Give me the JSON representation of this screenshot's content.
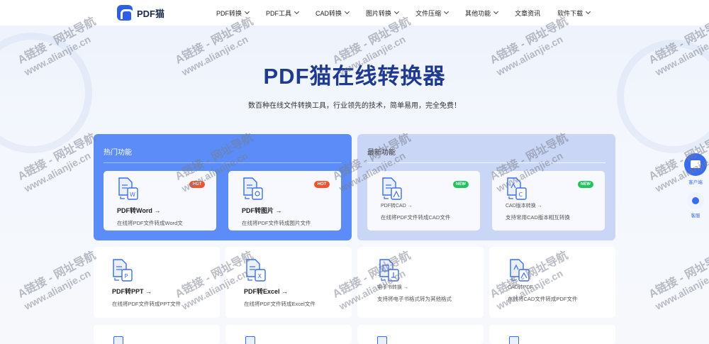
{
  "header": {
    "logo_text": "PDF猫",
    "nav": [
      {
        "label": "PDF转换",
        "chevron": true
      },
      {
        "label": "PDF工具",
        "chevron": true
      },
      {
        "label": "CAD转换",
        "chevron": true
      },
      {
        "label": "图片转换",
        "chevron": true
      },
      {
        "label": "文件压缩",
        "chevron": true
      },
      {
        "label": "其他功能",
        "chevron": true
      },
      {
        "label": "文章资讯",
        "chevron": false
      },
      {
        "label": "软件下载",
        "chevron": true
      }
    ]
  },
  "hero": {
    "title": "PDF猫在线转换器",
    "subtitle": "数百种在线文件转换工具，行业领先的技术，简单易用，完全免费！"
  },
  "hot_panel": {
    "title": "热门功能",
    "cards": [
      {
        "title": "PDF转Word →",
        "desc": "在线将PDF文件转成Word文",
        "badge": "HOT",
        "icon": "pdf-to-word-icon"
      },
      {
        "title": "PDF转图片 →",
        "desc": "在线将PDF文件转成图片文件",
        "badge": "HOT",
        "icon": "pdf-to-image-icon"
      }
    ]
  },
  "new_panel": {
    "title": "最新功能",
    "cards": [
      {
        "title": "PDF转CAD →",
        "desc": "在线将PDF文件转成CAD文件",
        "badge": "NEW",
        "icon": "pdf-to-cad-icon"
      },
      {
        "title": "CAD版本转换 →",
        "desc": "支持常用CAD版本相互转换",
        "badge": "NEW",
        "icon": "cad-version-icon"
      }
    ]
  },
  "grid_cards": [
    {
      "title": "PDF转PPT →",
      "desc": "在线将PDF文件转成PPT文件",
      "icon": "pdf-to-ppt-icon"
    },
    {
      "title": "PDF转Excel →",
      "desc": "在线将PDF文件转成Excel文件",
      "icon": "pdf-to-excel-icon"
    },
    {
      "title": "电子书转换 →",
      "desc": "支持将电子书格式转为其他格式",
      "icon": "ebook-convert-icon"
    },
    {
      "title": "CAD转PDF →",
      "desc": "在线将CAD文件转成PDF文件",
      "icon": "cad-to-pdf-icon"
    }
  ],
  "side": {
    "service_label": "客户端",
    "support_label": "客服"
  },
  "watermark": {
    "line1": "A链接 - 网址导航",
    "line2": "www.alianjie.cn"
  },
  "colors": {
    "primary": "#2d5fe6",
    "hot_panel": "#5b8cf7",
    "new_panel": "#c9d6f5",
    "title": "#1f3a8f",
    "hot_badge": "#f25230",
    "new_badge": "#20c45a"
  }
}
